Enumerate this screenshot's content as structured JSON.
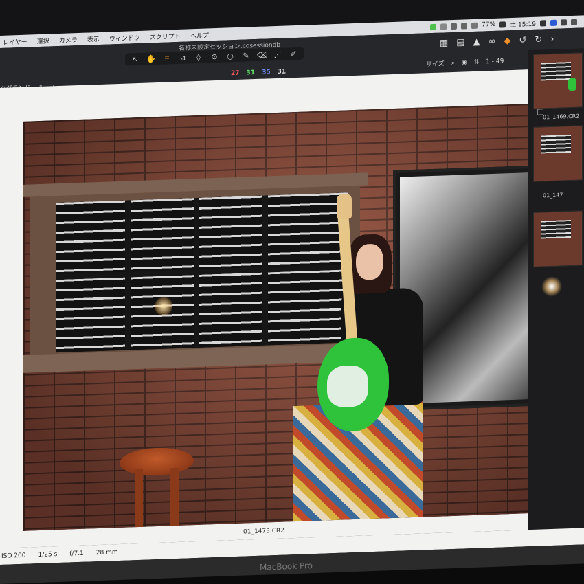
{
  "menubar": {
    "items": [
      "レイヤー",
      "選択",
      "カメラ",
      "表示",
      "ウィンドウ",
      "スクリプト",
      "ヘルプ"
    ],
    "battery": "77%",
    "clock": "土 15:19"
  },
  "titlebar": {
    "doc_title": "名称未設定セッション.cosessiondb",
    "background_label": "クグランド",
    "size_label": "サイズ",
    "range_label": "1 - 49"
  },
  "counts": [
    {
      "value": "27",
      "color": "#ff5a5a"
    },
    {
      "value": "31",
      "color": "#5fe06a"
    },
    {
      "value": "35",
      "color": "#6f8cff"
    },
    {
      "value": "31",
      "color": "#e8e8e8"
    }
  ],
  "tools": [
    "cursor-icon",
    "pan-icon",
    "crop-icon",
    "straighten-icon",
    "keystone-icon",
    "spot-icon",
    "circle-icon",
    "brush-icon",
    "eraser-icon",
    "gradient-icon",
    "picker-icon",
    "annotate-icon"
  ],
  "viewer": {
    "filename": "01_1473.CR2"
  },
  "browser": {
    "thumbs": [
      {
        "label": ""
      },
      {
        "label": "01_1469.CR2"
      },
      {
        "label": "01_147"
      },
      {
        "label": ""
      }
    ]
  },
  "status": {
    "iso": "ISO 200",
    "shutter": "1/25 s",
    "aperture": "f/7.1",
    "focal": "28 mm"
  },
  "bezel": {
    "model": "MacBook Pro"
  }
}
